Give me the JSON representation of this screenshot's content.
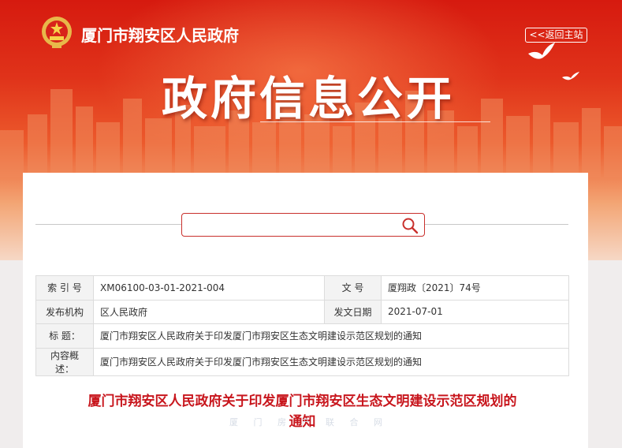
{
  "header": {
    "site_name": "厦门市翔安区人民政府",
    "home_link": "<<返回主站",
    "big_title": "政府信息公开"
  },
  "search": {
    "placeholder": "",
    "value": "",
    "icon": "search-icon"
  },
  "meta": {
    "index_label": "索 引 号",
    "index_value": "XM06100-03-01-2021-004",
    "docno_label": "文    号",
    "docno_value": "厦翔政〔2021〕74号",
    "org_label": "发布机构",
    "org_value": "区人民政府",
    "date_label": "发文日期",
    "date_value": "2021-07-01",
    "title_label": "标    题：",
    "title_value": "厦门市翔安区人民政府关于印发厦门市翔安区生态文明建设示范区规划的通知",
    "summary_label": "内容概述：",
    "summary_value": "厦门市翔安区人民政府关于印发厦门市翔安区生态文明建设示范区规划的通知"
  },
  "document": {
    "title_line1": "厦门市翔安区人民政府关于印发厦门市翔安区生态文明建设示范区规划的",
    "title_line2": "通知",
    "watermark": "厦 门 房 产 联 合 网"
  },
  "colors": {
    "brand_red": "#c8161d",
    "banner_red": "#d61a0f",
    "search_border": "#c9302c"
  }
}
